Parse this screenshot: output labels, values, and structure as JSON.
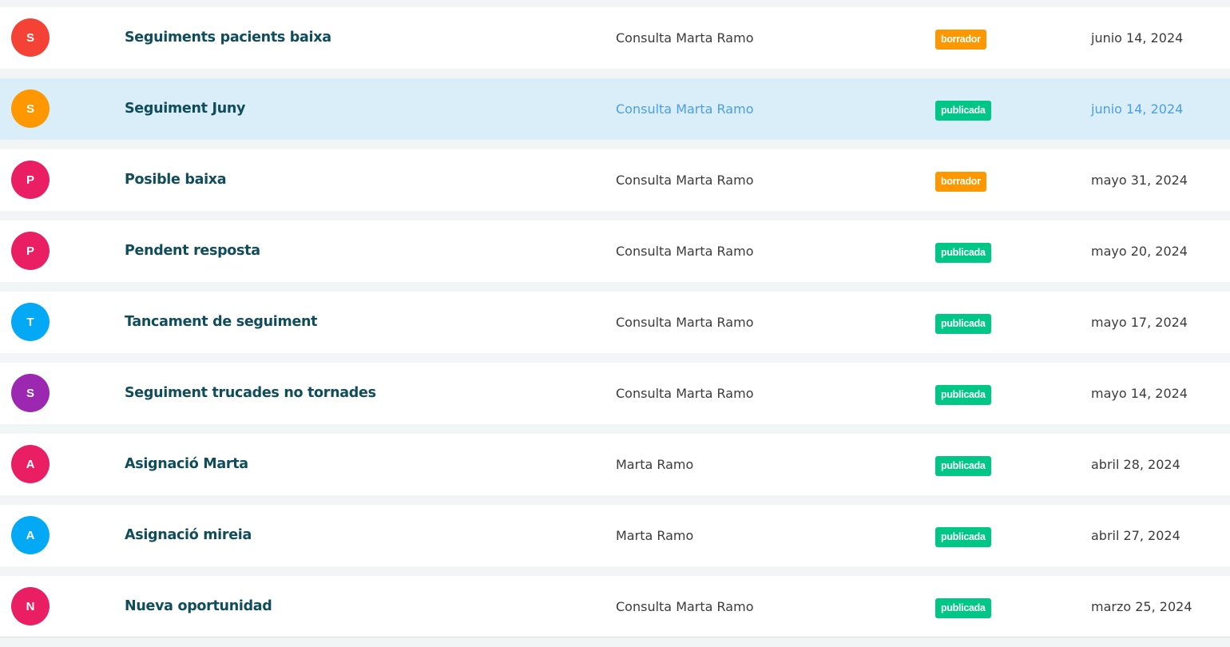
{
  "rows": [
    {
      "initial": "S",
      "avatar_color": "#f44336",
      "title": "Seguiments pacients baixa",
      "author": "Consulta Marta Ramo",
      "status": "borrador",
      "status_color": "#ff9800",
      "date": "junio 14, 2024",
      "highlighted": false
    },
    {
      "initial": "S",
      "avatar_color": "#ff9800",
      "title": "Seguiment Juny",
      "author": "Consulta Marta Ramo",
      "status": "publicada",
      "status_color": "#00c785",
      "date": "junio 14, 2024",
      "highlighted": true
    },
    {
      "initial": "P",
      "avatar_color": "#e91e63",
      "title": "Posible baixa",
      "author": "Consulta Marta Ramo",
      "status": "borrador",
      "status_color": "#ff9800",
      "date": "mayo 31, 2024",
      "highlighted": false
    },
    {
      "initial": "P",
      "avatar_color": "#e91e63",
      "title": "Pendent resposta",
      "author": "Consulta Marta Ramo",
      "status": "publicada",
      "status_color": "#00c785",
      "date": "mayo 20, 2024",
      "highlighted": false
    },
    {
      "initial": "T",
      "avatar_color": "#03a9f4",
      "title": "Tancament de seguiment",
      "author": "Consulta Marta Ramo",
      "status": "publicada",
      "status_color": "#00c785",
      "date": "mayo 17, 2024",
      "highlighted": false
    },
    {
      "initial": "S",
      "avatar_color": "#9c27b0",
      "title": "Seguiment trucades no tornades",
      "author": "Consulta Marta Ramo",
      "status": "publicada",
      "status_color": "#00c785",
      "date": "mayo 14, 2024",
      "highlighted": false
    },
    {
      "initial": "A",
      "avatar_color": "#e91e63",
      "title": "Asignació Marta",
      "author": "Marta Ramo",
      "status": "publicada",
      "status_color": "#00c785",
      "date": "abril 28, 2024",
      "highlighted": false
    },
    {
      "initial": "A",
      "avatar_color": "#03a9f4",
      "title": "Asignació mireia",
      "author": "Marta Ramo",
      "status": "publicada",
      "status_color": "#00c785",
      "date": "abril 27, 2024",
      "highlighted": false
    },
    {
      "initial": "N",
      "avatar_color": "#e91e63",
      "title": "Nueva oportunidad",
      "author": "Consulta Marta Ramo",
      "status": "publicada",
      "status_color": "#00c785",
      "date": "marzo 25, 2024",
      "highlighted": false
    }
  ]
}
